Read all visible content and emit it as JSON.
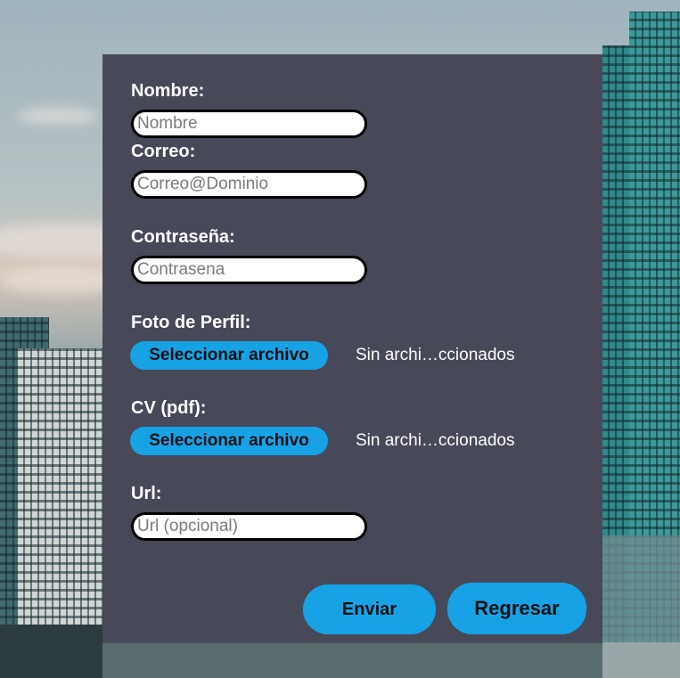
{
  "form": {
    "nombre": {
      "label": "Nombre:",
      "placeholder": "Nombre"
    },
    "correo": {
      "label": "Correo:",
      "placeholder": "Correo@Dominio"
    },
    "contrasena": {
      "label": "Contraseña:",
      "placeholder": "Contrasena"
    },
    "foto": {
      "label": "Foto de Perfil:",
      "button": "Seleccionar archivo",
      "status": "Sin archi…ccionados"
    },
    "cv": {
      "label": "CV (pdf):",
      "button": "Seleccionar archivo",
      "status": "Sin archi…ccionados"
    },
    "url": {
      "label": "Url:",
      "placeholder": "Url (opcional)"
    },
    "submit_label": "Enviar",
    "back_label": "Regresar"
  },
  "colors": {
    "card": "#474958",
    "accent": "#17a2e6"
  }
}
